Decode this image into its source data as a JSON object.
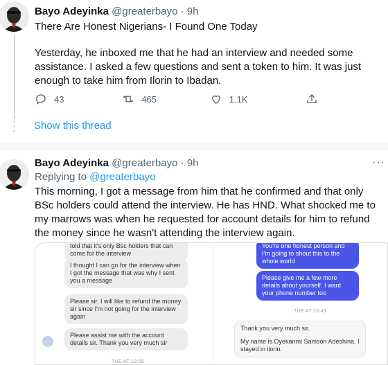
{
  "tweet1": {
    "name": "Bayo Adeyinka",
    "handle": "@greaterbayo",
    "separator": "·",
    "time": "9h",
    "title": "There Are Honest Nigerians- I Found One Today",
    "body": "Yesterday, he inboxed me that he had an interview and needed some assistance. I asked a few questions and sent a token to him. It was just enough to take him from Ilorin to Ibadan.",
    "replies": "43",
    "retweets": "465",
    "likes": "1.1K"
  },
  "show_thread": "Show this thread",
  "tweet2": {
    "name": "Bayo Adeyinka",
    "handle": "@greaterbayo",
    "separator": "·",
    "time": "9h",
    "more": "···",
    "replying_prefix": "Replying to ",
    "replying_handle": "@greaterbayo",
    "body": "This morning, I got a message from him that he confirmed and that only BSc holders could attend the interview. He has HND. What shocked me to my marrows was when he requested for account details for him to refund the money since he wasn't attending the interview again."
  },
  "screenshot": {
    "left": {
      "m1": "told that it's only Bsc holders that can come for the interview",
      "m2": "I thought I can go for the interview when I got the message that was why I sent you a message",
      "m3": "Please sir. I will like to refund the money sir since I'm not going for the interview again",
      "m4": "Please assist me with the account details sir. Thank you very much sir",
      "stamp": "TUE AT 13:09"
    },
    "right": {
      "m1": "You're one honest person and I'm going to shout this to the whole world",
      "m2": "Please give me a few more details about yourself. I want your phone number too",
      "stamp": "TUE AT 13:43",
      "m3a": "Thank you very much sir.",
      "m3b": "My name is Oyekanmi Samson Adeshina. I stayed in ilorin."
    }
  },
  "colors": {
    "accent": "#1d9bf0",
    "muted": "#536471",
    "messenger_blue": "#4b56e8"
  }
}
